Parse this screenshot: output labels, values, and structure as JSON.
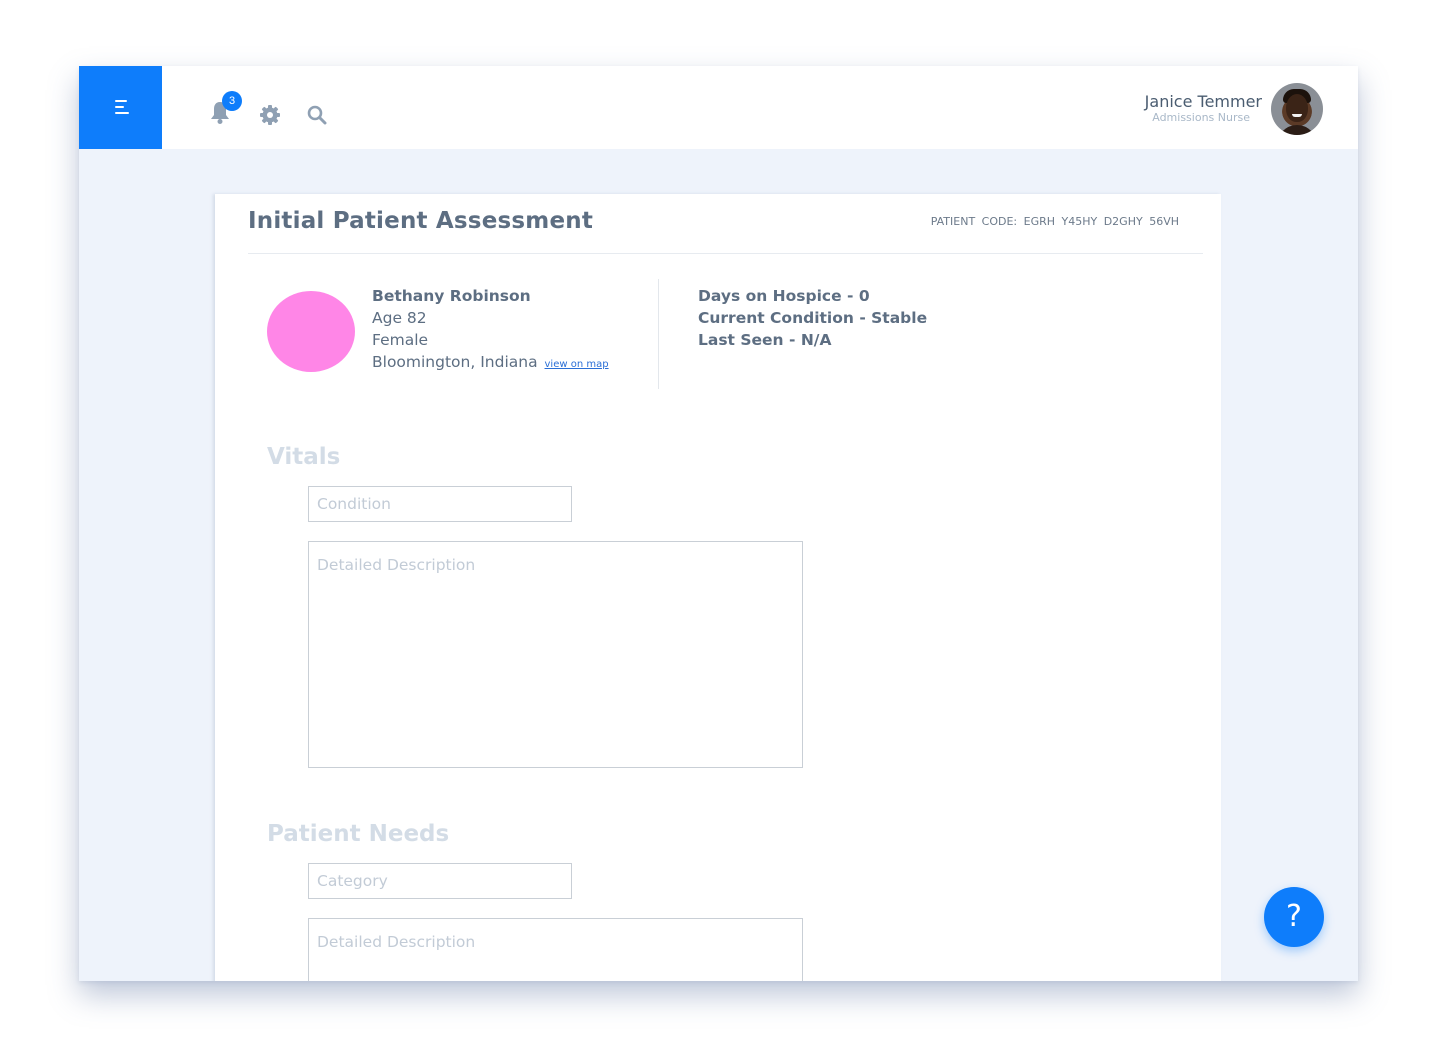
{
  "header": {
    "notifications_count": "3",
    "user_name": "Janice Temmer",
    "user_role": "Admissions Nurse"
  },
  "icons": {
    "menu": "menu-icon",
    "notifications": "bell-icon",
    "settings": "gear-icon",
    "search": "search-icon",
    "help": "?"
  },
  "colors": {
    "accent": "#0e7dfb",
    "patient_photo": "#ff86e7",
    "background": "#eef3fb"
  },
  "assessment": {
    "title": "Initial Patient Assessment",
    "patient_code": "PATIENT  CODE:  EGRH  Y45HY  D2GHY  56VH"
  },
  "patient": {
    "name": "Bethany Robinson",
    "age": "Age 82",
    "gender": "Female",
    "location": "Bloomington, Indiana",
    "map_link": "view on map"
  },
  "stats": {
    "days_on_hospice": "Days on Hospice - 0",
    "current_condition": "Current Condition - Stable",
    "last_seen": "Last Seen - N/A"
  },
  "vitals": {
    "title": "Vitals",
    "condition_placeholder": "Condition",
    "condition_value": "",
    "description_placeholder": "Detailed Description",
    "description_value": ""
  },
  "needs": {
    "title": "Patient Needs",
    "category_placeholder": "Category",
    "category_value": "",
    "description_placeholder": "Detailed Description",
    "description_value": ""
  }
}
